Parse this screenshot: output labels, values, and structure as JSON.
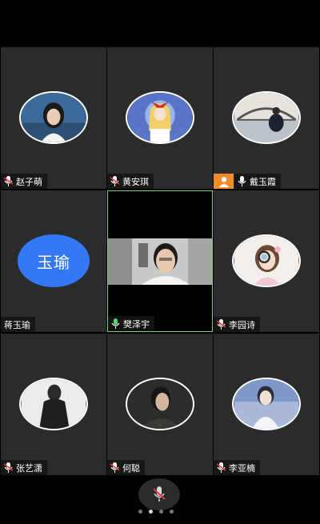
{
  "participants": [
    {
      "name": "赵子萌",
      "mic": "muted"
    },
    {
      "name": "黄安琪",
      "mic": "muted"
    },
    {
      "name": "戴玉霞",
      "mic": "muted",
      "host": true
    },
    {
      "name": "蒋玉瑜",
      "avatar_text": "玉瑜",
      "mic": "none"
    },
    {
      "name": "樊泽宇",
      "mic": "active",
      "video": true
    },
    {
      "name": "李园诗",
      "mic": "muted"
    },
    {
      "name": "张艺潇",
      "mic": "muted"
    },
    {
      "name": "何聪",
      "mic": "muted"
    },
    {
      "name": "李亚楠",
      "mic": "muted"
    }
  ],
  "controls": {
    "mic_icon": "microphone-muted-icon",
    "pages": 4,
    "current_page": 2
  },
  "colors": {
    "tile_bg": "#2a2b2d",
    "active_border": "#7fcf7f",
    "text_avatar": "#3478f6",
    "host_badge": "#f08c2c",
    "mic_muted": "#e04040",
    "mic_active": "#4cd964"
  }
}
